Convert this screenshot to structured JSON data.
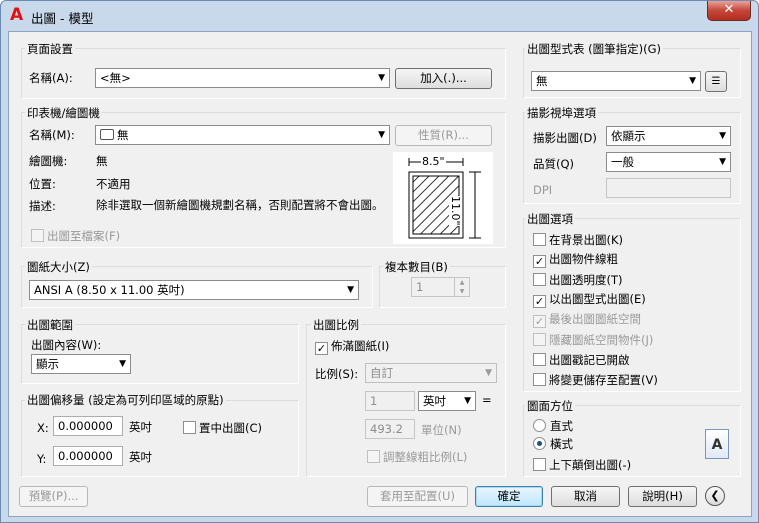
{
  "window": {
    "title": "出圖 - 模型",
    "close_glyph": "✕",
    "app_icon_glyph": "A"
  },
  "page_setup": {
    "group_title": "頁面設置",
    "name_label": "名稱(A):",
    "name_value": "<無>",
    "add_button": "加入(.)..."
  },
  "printer": {
    "group_title": "印表機/繪圖機",
    "name_label": "名稱(M):",
    "name_value": "無",
    "properties_button": "性質(R)...",
    "plotter_label": "繪圖機:",
    "plotter_value": "無",
    "location_label": "位置:",
    "location_value": "不適用",
    "description_label": "描述:",
    "description_value": "除非選取一個新繪圖機規劃名稱，否則配置將不會出圖。",
    "plot_to_file": "出圖至檔案(F)",
    "preview_width": "8.5\"",
    "preview_height": "11.0\""
  },
  "paper_size": {
    "group_title": "圖紙大小(Z)",
    "value": "ANSI A (8.50 x 11.00 英吋)"
  },
  "copies": {
    "group_title": "複本數目(B)",
    "value": "1"
  },
  "plot_area": {
    "group_title": "出圖範圍",
    "what_label": "出圖內容(W):",
    "what_value": "顯示"
  },
  "plot_offset": {
    "group_title": "出圖偏移量 (設定為可列印區域的原點)",
    "x_label": "X:",
    "x_value": "0.000000",
    "x_unit": "英吋",
    "y_label": "Y:",
    "y_value": "0.000000",
    "y_unit": "英吋",
    "center_plot": "置中出圖(C)"
  },
  "plot_scale": {
    "group_title": "出圖比例",
    "fit_to_paper": "佈滿圖紙(I)",
    "scale_label": "比例(S):",
    "scale_value": "自訂",
    "value1": "1",
    "unit_value": "英吋",
    "equals": "=",
    "value2": "493.2",
    "units_label": "單位(N)",
    "scale_lineweights": "調整線粗比例(L)"
  },
  "plot_style_table": {
    "group_title": "出圖型式表 (圖筆指定)(G)",
    "value": "無"
  },
  "shaded_viewport": {
    "group_title": "描影視埠選項",
    "shade_plot_label": "描影出圖(D)",
    "shade_plot_value": "依顯示",
    "quality_label": "品質(Q)",
    "quality_value": "一般",
    "dpi_label": "DPI"
  },
  "plot_options": {
    "group_title": "出圖選項",
    "items": [
      {
        "label": "在背景出圖(K)",
        "checked": false,
        "enabled": true
      },
      {
        "label": "出圖物件線粗",
        "checked": true,
        "enabled": true
      },
      {
        "label": "出圖透明度(T)",
        "checked": false,
        "enabled": true
      },
      {
        "label": "以出圖型式出圖(E)",
        "checked": true,
        "enabled": true
      },
      {
        "label": "最後出圖圖紙空間",
        "checked": true,
        "enabled": false
      },
      {
        "label": "隱藏圖紙空間物件(J)",
        "checked": false,
        "enabled": false
      },
      {
        "label": "出圖戳記已開啟",
        "checked": false,
        "enabled": true
      },
      {
        "label": "將變更儲存至配置(V)",
        "checked": false,
        "enabled": true
      }
    ]
  },
  "drawing_orientation": {
    "group_title": "圖面方位",
    "portrait": "直式",
    "landscape": "橫式",
    "upside_down": "上下顛倒出圖(-)",
    "selected": "landscape",
    "orientation_icon_glyph": "A"
  },
  "footer": {
    "preview": "預覽(P)...",
    "apply_to_layout": "套用至配置(U)",
    "ok": "確定",
    "cancel": "取消",
    "help": "說明(H)",
    "collapse_glyph": "❮"
  }
}
